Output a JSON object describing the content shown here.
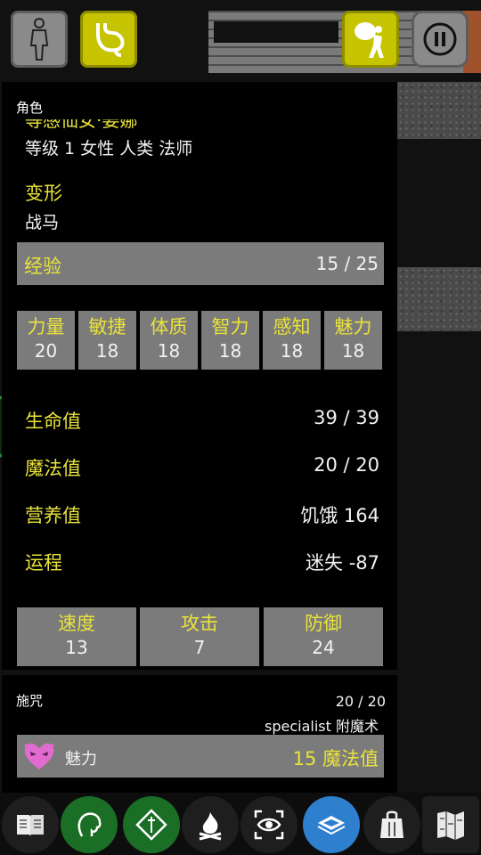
{
  "window_title": "角色",
  "character": {
    "name_partial": "等感仙女·姜娜",
    "description": "等级 1 女性 人类 法师",
    "transform_label": "变形",
    "transform_value": "战马"
  },
  "experience": {
    "label": "经验",
    "value": "15 / 25"
  },
  "attributes": [
    {
      "name": "力量",
      "value": "20"
    },
    {
      "name": "敏捷",
      "value": "18"
    },
    {
      "name": "体质",
      "value": "18"
    },
    {
      "name": "智力",
      "value": "18"
    },
    {
      "name": "感知",
      "value": "18"
    },
    {
      "name": "魅力",
      "value": "18"
    }
  ],
  "vitals": [
    {
      "label": "生命值",
      "value": "39 / 39"
    },
    {
      "label": "魔法值",
      "value": "20 / 20"
    },
    {
      "label": "营养值",
      "value": "饥饿 164"
    },
    {
      "label": "运程",
      "value": "迷失 -87"
    }
  ],
  "combat": [
    {
      "name": "速度",
      "value": "13"
    },
    {
      "name": "攻击",
      "value": "7"
    },
    {
      "name": "防御",
      "value": "24"
    }
  ],
  "spell_section": {
    "title": "施咒",
    "mana": "20 / 20",
    "specialist": "specialist 附魔术",
    "spell": {
      "name": "魅力",
      "cost": "15 魔法值",
      "icon": "heart-mask-icon"
    }
  },
  "top_buttons": [
    {
      "icon": "person-icon"
    },
    {
      "icon": "stomach-icon"
    },
    {
      "icon": "carry-pack-icon"
    },
    {
      "icon": "pause-icon"
    }
  ],
  "bottom_bar": [
    {
      "icon": "book-icon"
    },
    {
      "icon": "head-icon"
    },
    {
      "icon": "dagger-diamond-icon"
    },
    {
      "icon": "campfire-icon"
    },
    {
      "icon": "eye-focus-icon"
    },
    {
      "icon": "map-layers-icon"
    },
    {
      "icon": "gift-bag-icon"
    },
    {
      "icon": "dungeon-map-icon"
    }
  ],
  "colors": {
    "accent_yellow": "#e9e33b",
    "panel_gray": "#7b7b7b",
    "green": "#1a6e26",
    "blue": "#2f7fcf"
  }
}
